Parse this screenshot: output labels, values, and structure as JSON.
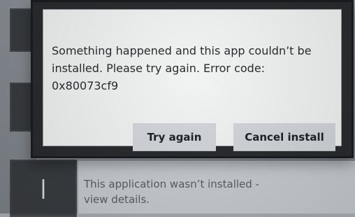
{
  "dialog": {
    "message_lines": [
      "Something happened and this app couldn’t be",
      "installed. Please try again. Error code:",
      "0x80073cf9"
    ],
    "buttons": {
      "try_again": "Try again",
      "cancel_install": "Cancel install"
    }
  },
  "notification": {
    "text_lines": [
      "This application wasn’t installed -",
      "view details."
    ]
  },
  "icons": {
    "tile_1": "app-tile-icon",
    "tile_2": "app-tile-icon",
    "tile_3": "app-tile-icon"
  }
}
